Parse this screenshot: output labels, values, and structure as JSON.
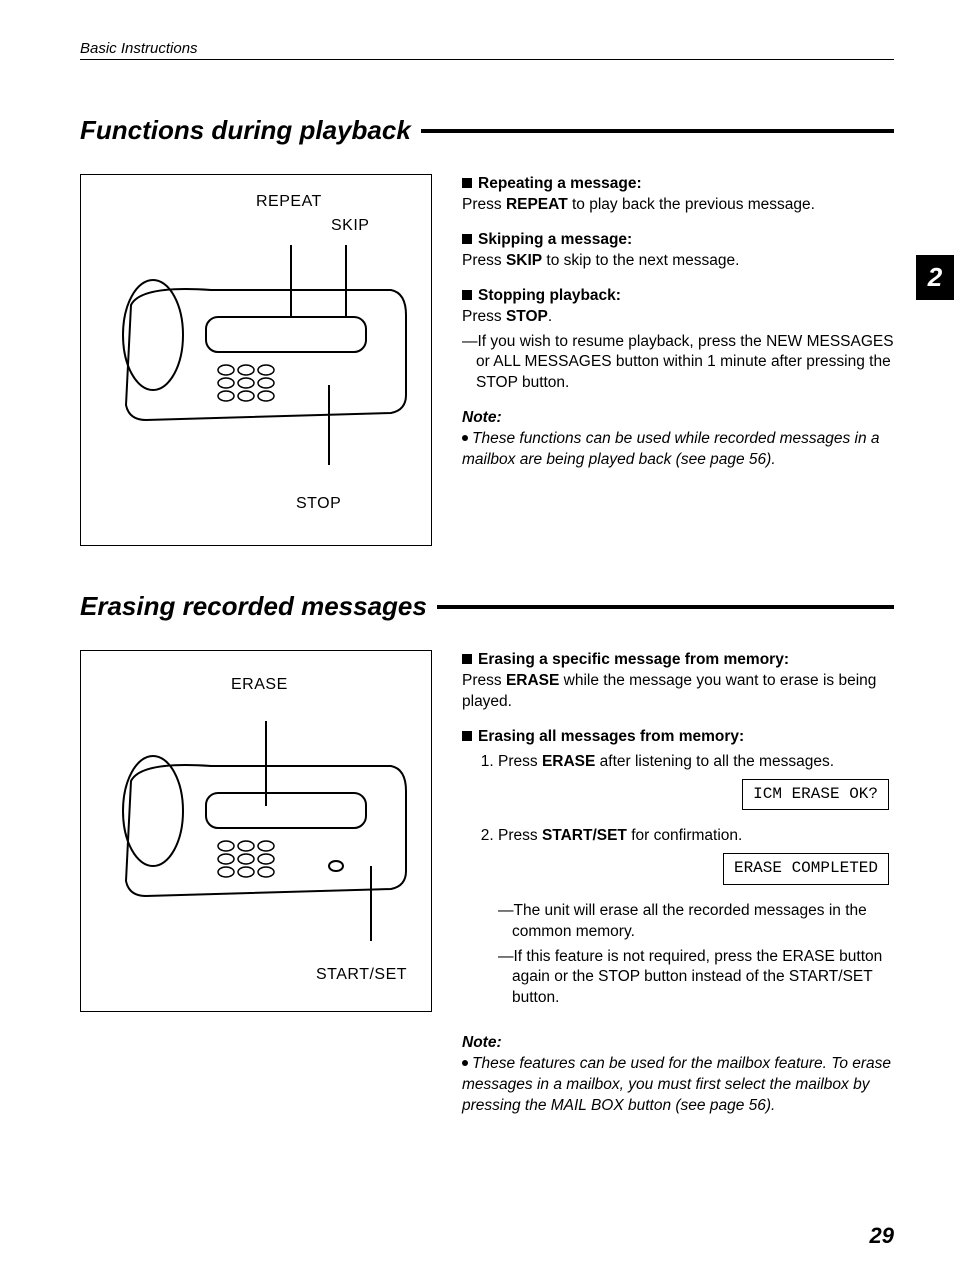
{
  "running_head": "Basic Instructions",
  "chapter_tab": "2",
  "page_number": "29",
  "section1": {
    "title": "Functions during playback",
    "figure_labels": {
      "repeat": "REPEAT",
      "skip": "SKIP",
      "stop": "STOP"
    },
    "repeat": {
      "title": "Repeating a message:",
      "body_a": "Press ",
      "body_bold": "REPEAT",
      "body_b": " to play back the previous message."
    },
    "skip": {
      "title": "Skipping a message:",
      "body_a": "Press ",
      "body_bold": "SKIP",
      "body_b": " to skip to the next message."
    },
    "stop": {
      "title": "Stopping playback:",
      "line_a": "Press ",
      "line_bold": "STOP",
      "line_b": ".",
      "dash": "—If you wish to resume playback, press the NEW MESSAGES or ALL MESSAGES button within 1 minute after pressing the STOP button."
    },
    "note_head": "Note:",
    "note_body": "These functions can be used while recorded messages in a mailbox are being played back (see page 56)."
  },
  "section2": {
    "title": "Erasing recorded messages",
    "figure_labels": {
      "erase": "ERASE",
      "startset": "START/SET"
    },
    "specific": {
      "title": "Erasing a specific message from memory:",
      "body_a": "Press ",
      "body_bold": "ERASE",
      "body_b": " while the message you want to erase is being played."
    },
    "all": {
      "title": "Erasing all messages from memory:",
      "step1_a": "Press ",
      "step1_bold": "ERASE",
      "step1_b": " after listening to all the messages.",
      "lcd1": "ICM ERASE OK?",
      "step2_a": "Press ",
      "step2_bold": "START/SET",
      "step2_b": " for confirmation.",
      "lcd2": "ERASE COMPLETED",
      "dash1": "—The unit will erase all the recorded messages in the common memory.",
      "dash2": "—If this feature is not required, press the ERASE button again or the STOP button instead of the START/SET button."
    },
    "note_head": "Note:",
    "note_body": "These features can be used for the mailbox feature. To erase messages in a mailbox, you must first select the mailbox by pressing the MAIL BOX button (see page 56)."
  }
}
